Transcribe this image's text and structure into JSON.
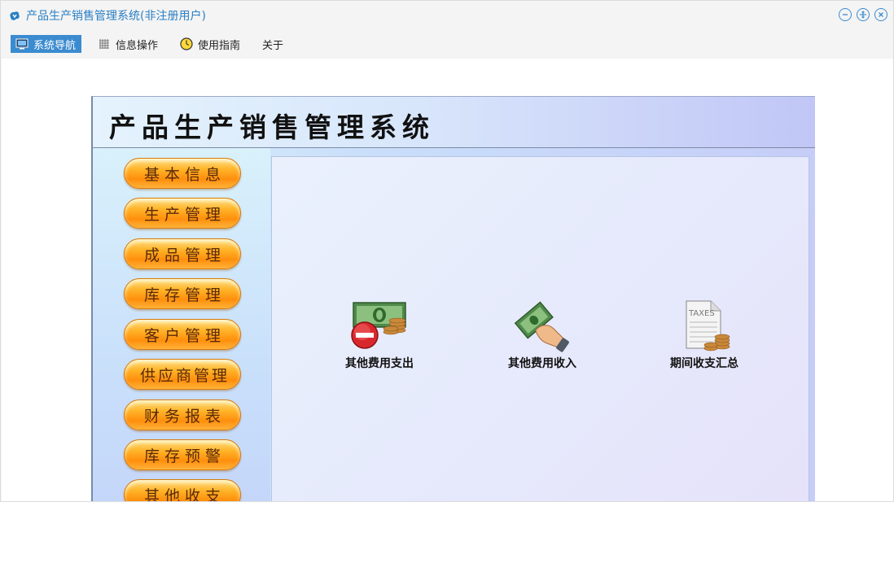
{
  "window": {
    "title": "产品生产销售管理系统(非注册用户)",
    "icons": [
      "minimize-icon",
      "maximize-icon",
      "close-icon"
    ],
    "accent": "#3b8bd0"
  },
  "menu": {
    "items": [
      {
        "label": "系统导航",
        "icon": "monitor-icon",
        "active": true
      },
      {
        "label": "信息操作",
        "icon": "grid-icon",
        "active": false
      },
      {
        "label": "使用指南",
        "icon": "clock-icon",
        "active": false
      },
      {
        "label": "关于",
        "icon": "",
        "active": false
      }
    ]
  },
  "nav": {
    "title": "产品生产销售管理系统",
    "sidebar": [
      {
        "label": "基本信息"
      },
      {
        "label": "生产管理"
      },
      {
        "label": "成品管理"
      },
      {
        "label": "库存管理"
      },
      {
        "label": "客户管理"
      },
      {
        "label": "供应商管理"
      },
      {
        "label": "财务报表"
      },
      {
        "label": "库存预警"
      },
      {
        "label": "其他收支"
      }
    ],
    "functions": [
      {
        "label": "其他费用支出",
        "icon": "money-remove-icon"
      },
      {
        "label": "其他费用收入",
        "icon": "money-hand-icon"
      },
      {
        "label": "期间收支汇总",
        "icon": "taxes-document-icon",
        "icon_text": "TAXES"
      }
    ]
  }
}
